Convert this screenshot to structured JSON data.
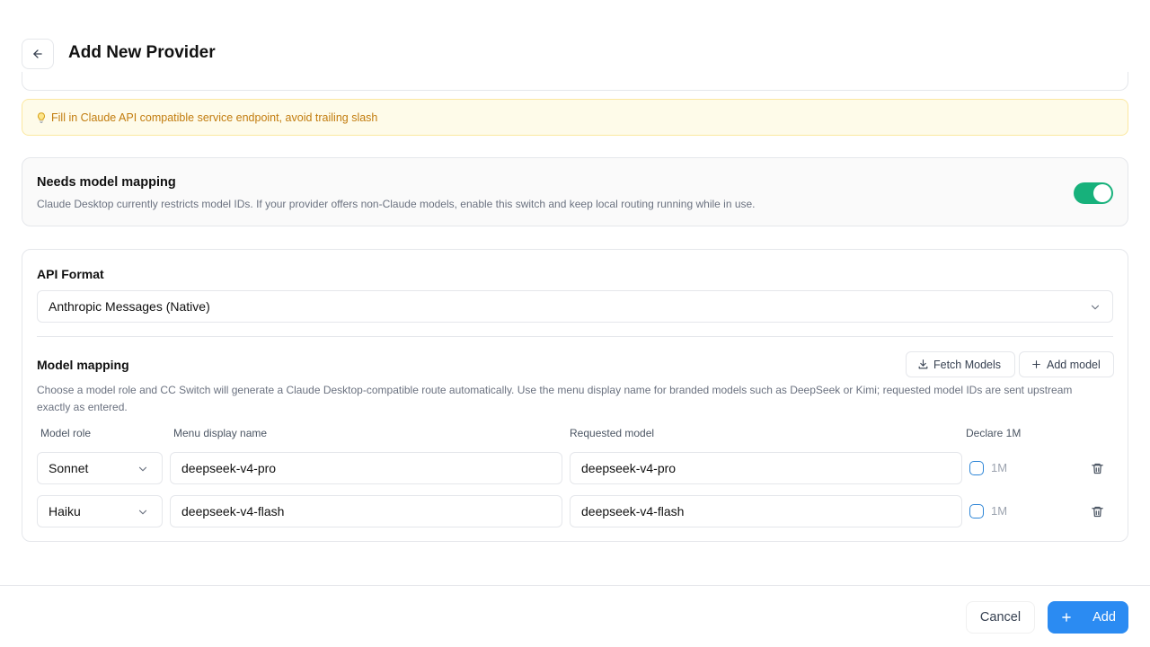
{
  "header": {
    "title": "Add New Provider"
  },
  "hint": {
    "text": "Fill in Claude API compatible service endpoint, avoid trailing slash"
  },
  "model_mapping_toggle": {
    "title": "Needs model mapping",
    "description": "Claude Desktop currently restricts model IDs. If your provider offers non-Claude models, enable this switch and keep local routing running while in use.",
    "enabled": true
  },
  "api_format": {
    "label": "API Format",
    "selected": "Anthropic Messages (Native)"
  },
  "model_mapping": {
    "label": "Model mapping",
    "fetch_label": "Fetch Models",
    "add_label": "Add model",
    "description": "Choose a model role and CC Switch will generate a Claude Desktop-compatible route automatically. Use the menu display name for branded models such as DeepSeek or Kimi; requested model IDs are sent upstream exactly as entered.",
    "columns": [
      "Model role",
      "Menu display name",
      "Requested model",
      "Declare 1M"
    ],
    "rows": [
      {
        "role": "Sonnet",
        "display_name": "deepseek-v4-pro",
        "requested": "deepseek-v4-pro",
        "flag": "1M",
        "checked": false
      },
      {
        "role": "Haiku",
        "display_name": "deepseek-v4-flash",
        "requested": "deepseek-v4-flash",
        "flag": "1M",
        "checked": false
      }
    ]
  },
  "footer": {
    "cancel_label": "Cancel",
    "add_label": "Add"
  },
  "colors": {
    "accent": "#2b8bf2",
    "toggle_on": "#17b17b",
    "hint_text": "#c27c0e",
    "hint_bg": "#fefbe9"
  }
}
